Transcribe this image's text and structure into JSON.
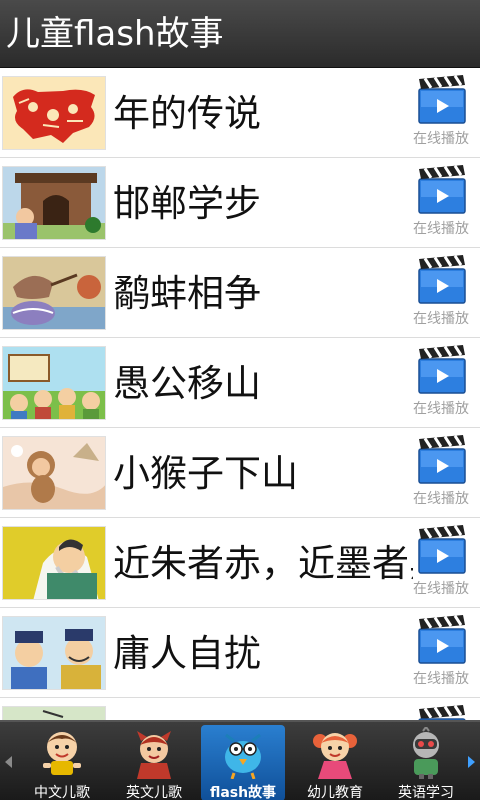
{
  "app": {
    "title": "儿童flash故事"
  },
  "stories": [
    {
      "title": "年的传说",
      "play_label": "在线播放",
      "thumb_icon": "nian-monster-papercut-thumbnail"
    },
    {
      "title": "邯郸学步",
      "play_label": "在线播放",
      "thumb_icon": "city-gate-thumbnail"
    },
    {
      "title": "鹬蚌相争",
      "play_label": "在线播放",
      "thumb_icon": "bird-clam-thumbnail"
    },
    {
      "title": "愚公移山",
      "play_label": "在线播放",
      "thumb_icon": "old-man-mountain-thumbnail"
    },
    {
      "title": "小猴子下山",
      "play_label": "在线播放",
      "thumb_icon": "monkey-thumbnail"
    },
    {
      "title": "近朱者赤，近墨者黑",
      "play_label": "在线播放",
      "thumb_icon": "scholar-thumbnail"
    },
    {
      "title": "庸人自扰",
      "play_label": "在线播放",
      "thumb_icon": "officials-thumbnail"
    },
    {
      "title": "",
      "play_label": "",
      "thumb_icon": "partial-thumbnail"
    }
  ],
  "tabs": [
    {
      "label": "中文儿歌",
      "icon": "cartoon-boy-icon",
      "active": false
    },
    {
      "label": "英文儿歌",
      "icon": "cartoon-devil-icon",
      "active": false
    },
    {
      "label": "flash故事",
      "icon": "cartoon-bird-icon",
      "active": true
    },
    {
      "label": "幼儿教育",
      "icon": "cartoon-girl-icon",
      "active": false
    },
    {
      "label": "英语学习",
      "icon": "cartoon-robot-icon",
      "active": false
    }
  ],
  "colors": {
    "titlebar": "#3a3a3a",
    "active_tab": "#1a66b8",
    "play_label": "#a0a0a0",
    "clapper_blue": "#2d7fe0"
  }
}
